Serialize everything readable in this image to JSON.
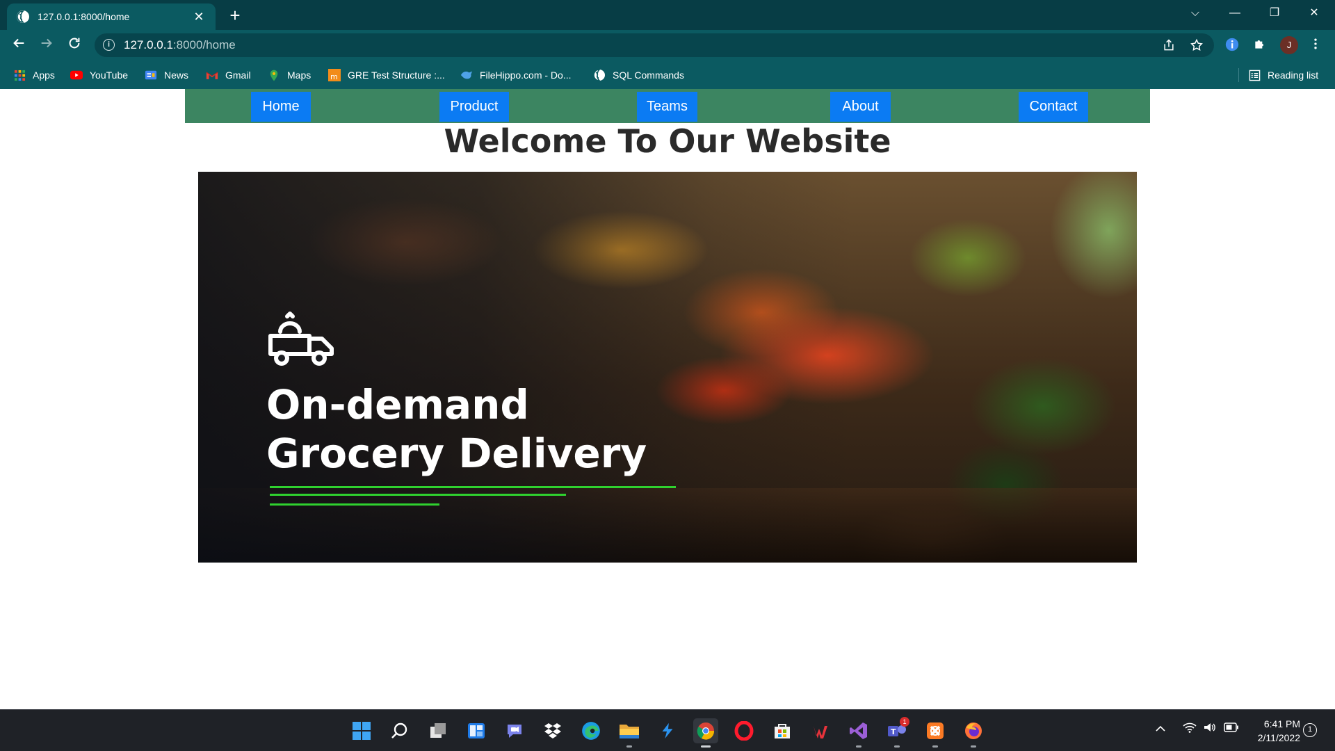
{
  "browser": {
    "tab_title": "127.0.0.1:8000/home",
    "tab_close": "✕",
    "new_tab": "+",
    "url_host": "127.0.0.1",
    "url_path": ":8000/home",
    "profile_initial": "J",
    "window_controls": {
      "tabsearch": "⌵",
      "minimize": "—",
      "restore": "❐",
      "close": "✕"
    }
  },
  "bookmarks": [
    {
      "label": "Apps",
      "icon": "apps-grid-icon"
    },
    {
      "label": "YouTube",
      "icon": "youtube-icon"
    },
    {
      "label": "News",
      "icon": "google-news-icon"
    },
    {
      "label": "Gmail",
      "icon": "gmail-icon"
    },
    {
      "label": "Maps",
      "icon": "maps-icon"
    },
    {
      "label": "GRE Test Structure :...",
      "icon": "magoosh-icon"
    },
    {
      "label": "FileHippo.com - Do...",
      "icon": "filehippo-icon"
    },
    {
      "label": "SQL Commands",
      "icon": "globe-icon"
    }
  ],
  "reading_list": "Reading list",
  "site": {
    "nav": [
      "Home",
      "Product",
      "Teams",
      "About",
      "Contact"
    ],
    "title": "Welcome To Our Website",
    "hero": {
      "line1": "On-demand",
      "line2": "Grocery Delivery"
    }
  },
  "taskbar": {
    "time": "6:41 PM",
    "date": "2/11/2022",
    "notification_count": "1",
    "teams_badge": "1"
  },
  "colors": {
    "chrome_dark": "#073d45",
    "chrome_toolbar": "#0b5a61",
    "site_nav_bg": "#3c8561",
    "nav_button": "#0b7bf3",
    "hero_accent": "#2fd12f"
  }
}
